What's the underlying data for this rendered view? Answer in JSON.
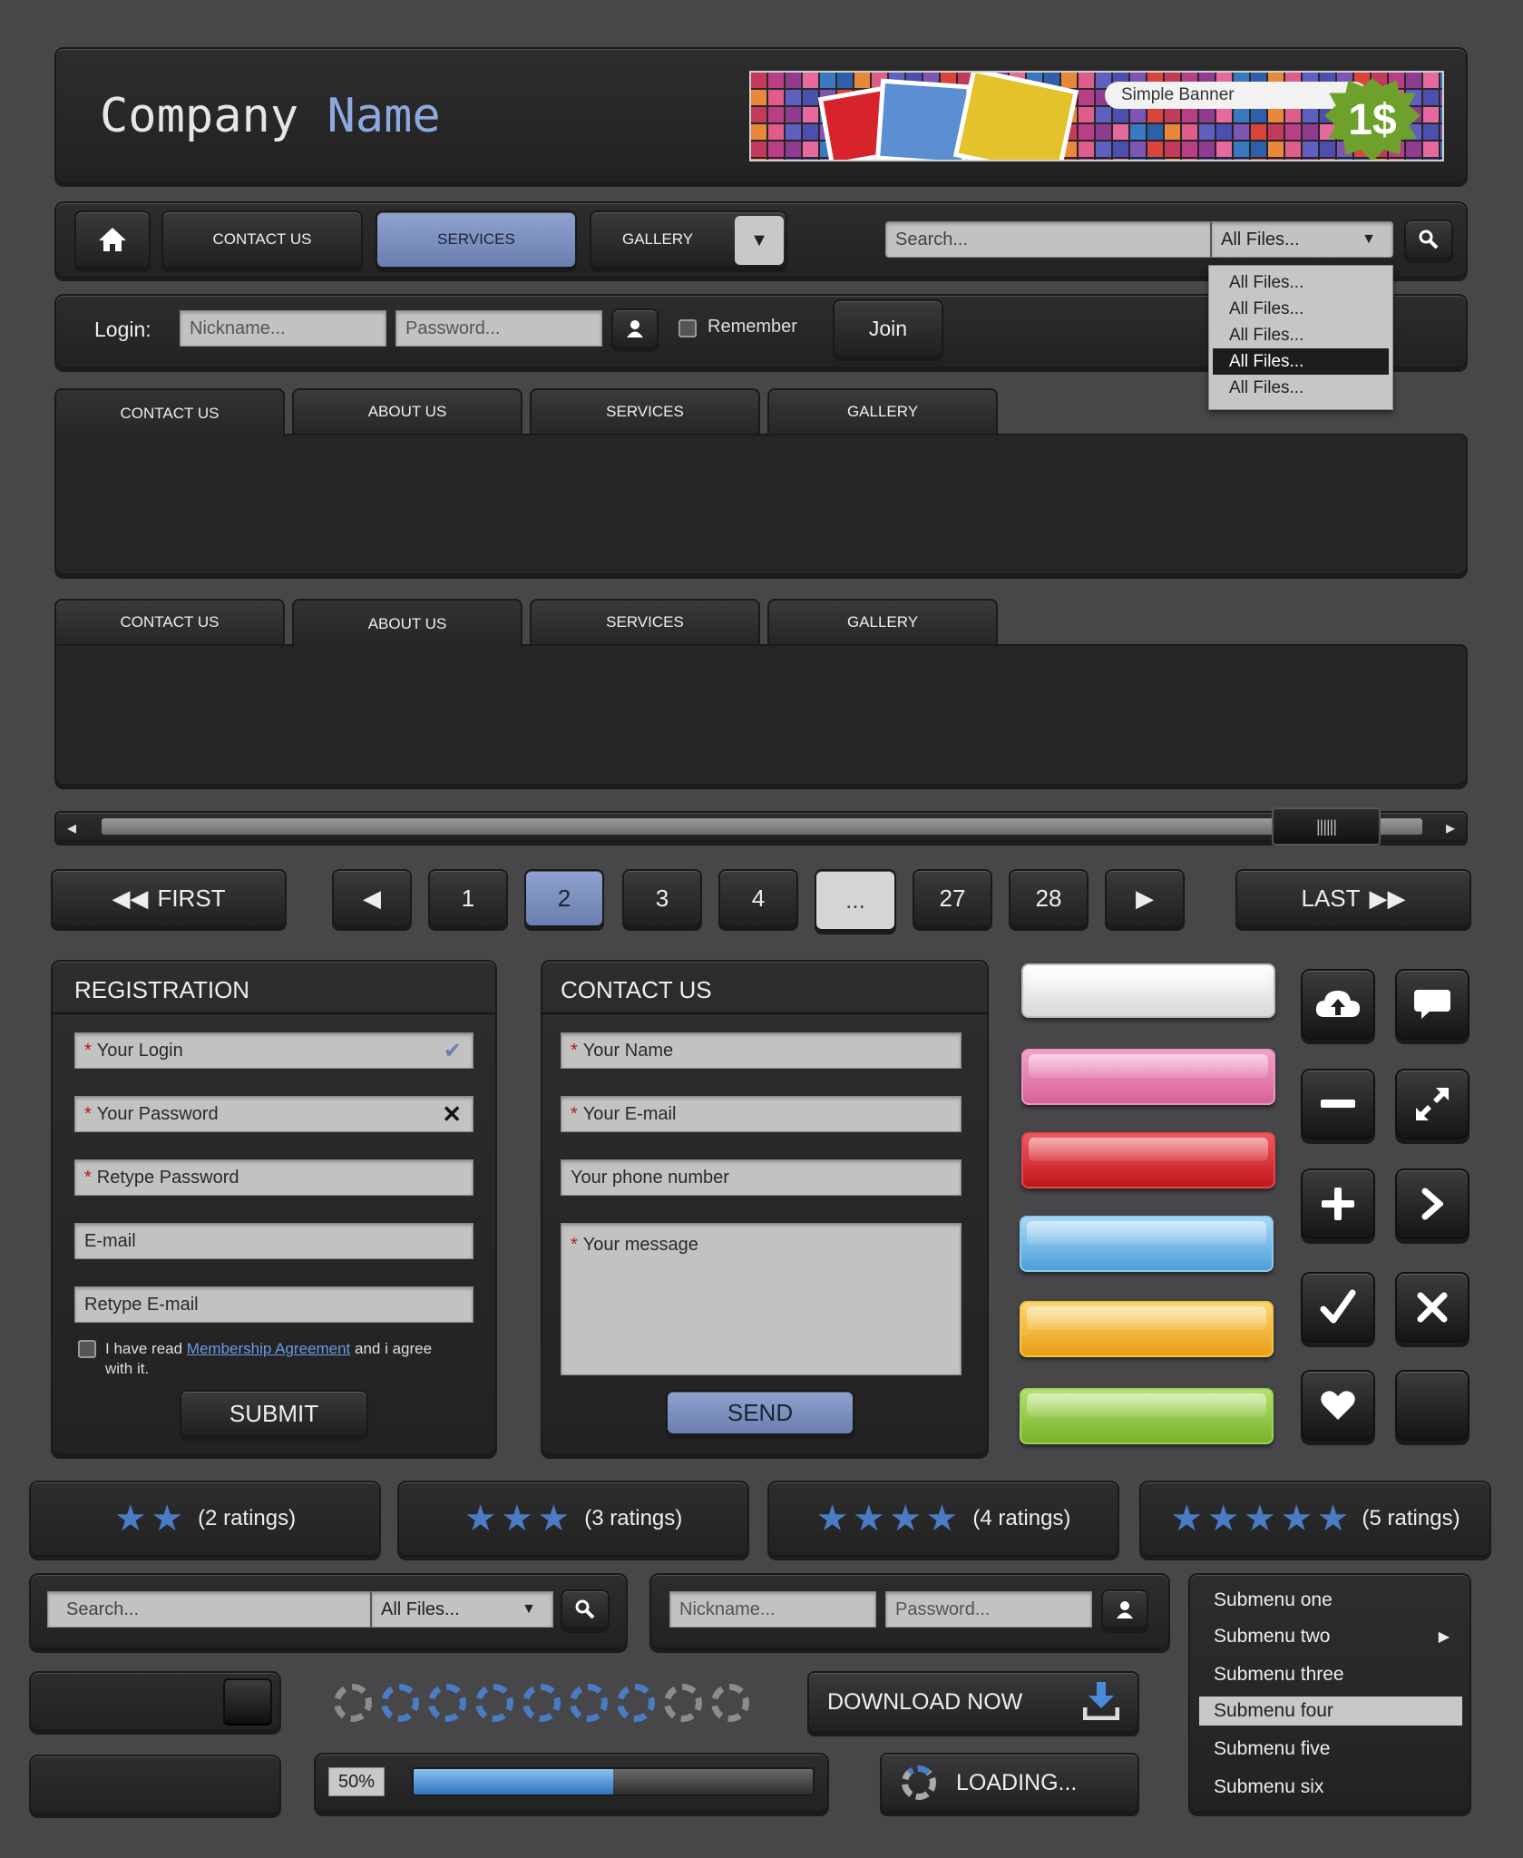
{
  "header": {
    "company_first": "Company",
    "company_second": "Name",
    "banner_label": "Simple Banner",
    "banner_price": "1$"
  },
  "nav": {
    "items": [
      "CONTACT US",
      "SERVICES",
      "GALLERY"
    ],
    "search_placeholder": "Search...",
    "filter_value": "All Files...",
    "dropdown_options": [
      "All Files...",
      "All Files...",
      "All Files...",
      "All Files...",
      "All Files..."
    ]
  },
  "login": {
    "label": "Login:",
    "nickname_placeholder": "Nickname...",
    "password_placeholder": "Password...",
    "remember": "Remember",
    "join": "Join"
  },
  "tabs1": [
    "CONTACT US",
    "ABOUT US",
    "SERVICES",
    "GALLERY"
  ],
  "tabs2": [
    "CONTACT US",
    "ABOUT US",
    "SERVICES",
    "GALLERY"
  ],
  "pagination": {
    "first": "FIRST",
    "last": "LAST",
    "pages": [
      "1",
      "2",
      "3",
      "4",
      "...",
      "27",
      "28"
    ],
    "current": "2"
  },
  "registration": {
    "title": "REGISTRATION",
    "fields": [
      "Your Login",
      "Your Password",
      "Retype Password",
      "E-mail",
      "Retype E-mail"
    ],
    "agree_prefix": "I have read",
    "agree_link": "Membership Agreement",
    "agree_suffix": "and i agree",
    "agree_line2": "with it.",
    "submit": "SUBMIT"
  },
  "contact": {
    "title": "CONTACT US",
    "fields": [
      "Your Name",
      "Your E-mail",
      "Your phone number"
    ],
    "message": "Your message",
    "send": "SEND"
  },
  "gloss_colors": [
    "#e8e8e8",
    "#e07aa8",
    "#d3262c",
    "#6cb3e4",
    "#efb428",
    "#8cc63f"
  ],
  "icon_buttons": [
    "cloud-upload-icon",
    "speech-bubble-icon",
    "minus-icon",
    "expand-icon",
    "plus-icon",
    "chevron-right-icon",
    "check-icon",
    "close-icon",
    "heart-icon",
    "blank-icon"
  ],
  "ratings": [
    {
      "stars": 2,
      "label": "(2 ratings)"
    },
    {
      "stars": 3,
      "label": "(3 ratings)"
    },
    {
      "stars": 4,
      "label": "(4 ratings)"
    },
    {
      "stars": 5,
      "label": "(5 ratings)"
    }
  ],
  "search2": {
    "placeholder": "Search...",
    "filter": "All Files..."
  },
  "login2": {
    "nickname_placeholder": "Nickname...",
    "password_placeholder": "Password..."
  },
  "submenu": {
    "items": [
      "Submenu one",
      "Submenu two",
      "Submenu three",
      "Submenu four",
      "Submenu five",
      "Submenu six"
    ],
    "selected": "Submenu four"
  },
  "loader": {
    "active_rings": 6,
    "total_rings": 9
  },
  "download": "DOWNLOAD NOW",
  "progress": {
    "label": "50%",
    "value": 0.5
  },
  "loading": "LOADING..."
}
